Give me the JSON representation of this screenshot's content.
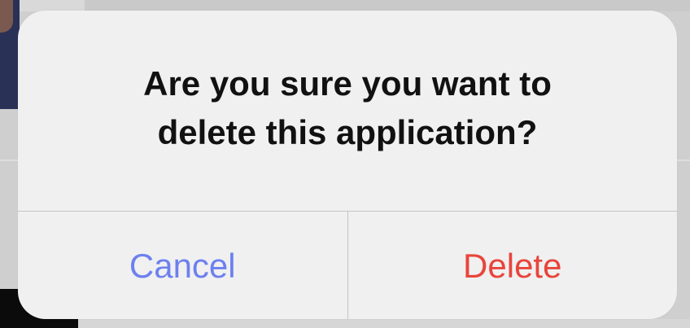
{
  "dialog": {
    "message": "Are you sure you want to delete this application?",
    "cancel_label": "Cancel",
    "delete_label": "Delete"
  },
  "colors": {
    "cancel": "#6d80ef",
    "destructive": "#e8453b",
    "text": "#111111",
    "dialog_background": "#f0f0f0"
  }
}
